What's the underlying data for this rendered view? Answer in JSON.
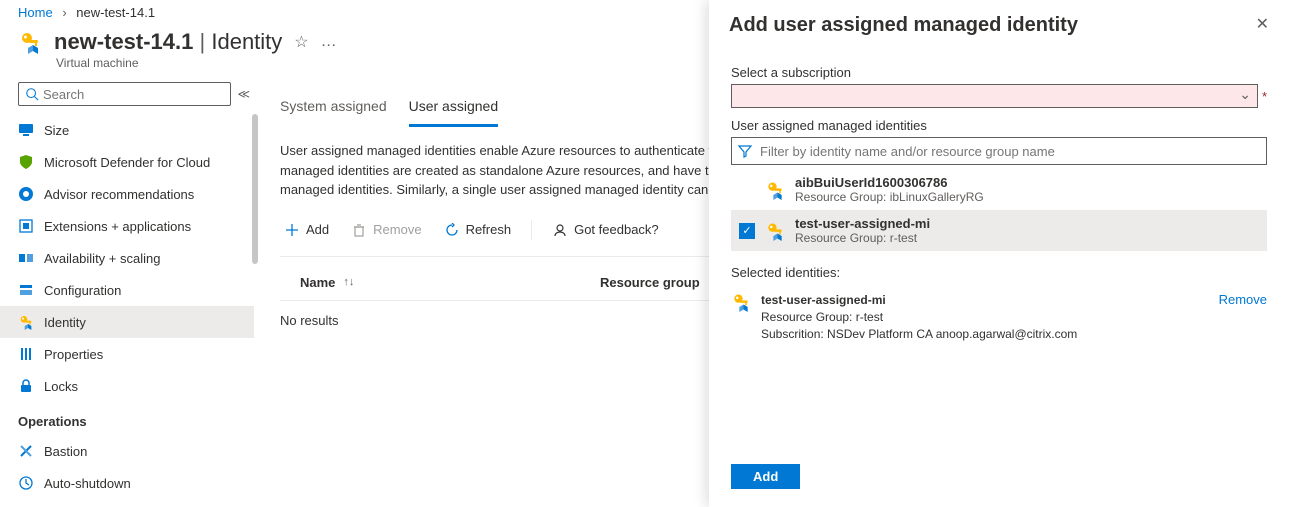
{
  "breadcrumb": {
    "root": "Home",
    "current": "new-test-14.1"
  },
  "header": {
    "resource_name": "new-test-14.1",
    "blade_title": "Identity",
    "resource_type": "Virtual machine"
  },
  "sidebar": {
    "search_placeholder": "Search",
    "items": [
      {
        "icon": "monitor-icon",
        "label": "Size"
      },
      {
        "icon": "shield-icon",
        "label": "Microsoft Defender for Cloud"
      },
      {
        "icon": "advisor-icon",
        "label": "Advisor recommendations"
      },
      {
        "icon": "extensions-icon",
        "label": "Extensions + applications"
      },
      {
        "icon": "availability-icon",
        "label": "Availability + scaling"
      },
      {
        "icon": "config-icon",
        "label": "Configuration"
      },
      {
        "icon": "identity-icon",
        "label": "Identity",
        "active": true
      },
      {
        "icon": "properties-icon",
        "label": "Properties"
      },
      {
        "icon": "lock-icon",
        "label": "Locks"
      }
    ],
    "group_operations": "Operations",
    "ops_items": [
      {
        "icon": "bastion-icon",
        "label": "Bastion"
      },
      {
        "icon": "autoshutdown-icon",
        "label": "Auto-shutdown"
      }
    ]
  },
  "main": {
    "tabs": {
      "system": "System assigned",
      "user": "User assigned"
    },
    "description": "User assigned managed identities enable Azure resources to authenticate to cloud services (e.g. Azure Key Vault) without storing credentials in code. User assigned managed identities are created as standalone Azure resources, and have their own lifecycle. A single resource (e.g. Virtual Machine) can utilize multiple user assigned managed identities. Similarly, a single user assigned managed identity can be shared across multiple resources.",
    "toolbar": {
      "add": "Add",
      "remove": "Remove",
      "refresh": "Refresh",
      "feedback": "Got feedback?"
    },
    "table": {
      "col_name": "Name",
      "col_rg": "Resource group",
      "empty": "No results"
    }
  },
  "panel": {
    "title": "Add user assigned managed identity",
    "select_sub_label": "Select a subscription",
    "uami_label": "User assigned managed identities",
    "filter_placeholder": "Filter by identity name and/or resource group name",
    "identities": [
      {
        "name": "aibBuiUserId1600306786",
        "rg": "Resource Group: ibLinuxGalleryRG",
        "checked": false
      },
      {
        "name": "test-user-assigned-mi",
        "rg": "Resource Group: r-test",
        "checked": true
      }
    ],
    "selected_label": "Selected identities:",
    "selected": {
      "name": "test-user-assigned-mi",
      "rg": "Resource Group: r-test",
      "sub": "Subscrition: NSDev Platform CA anoop.agarwal@citrix.com",
      "remove": "Remove"
    },
    "add_button": "Add"
  },
  "icons": {
    "key_badge_svg": "M0 0"
  }
}
